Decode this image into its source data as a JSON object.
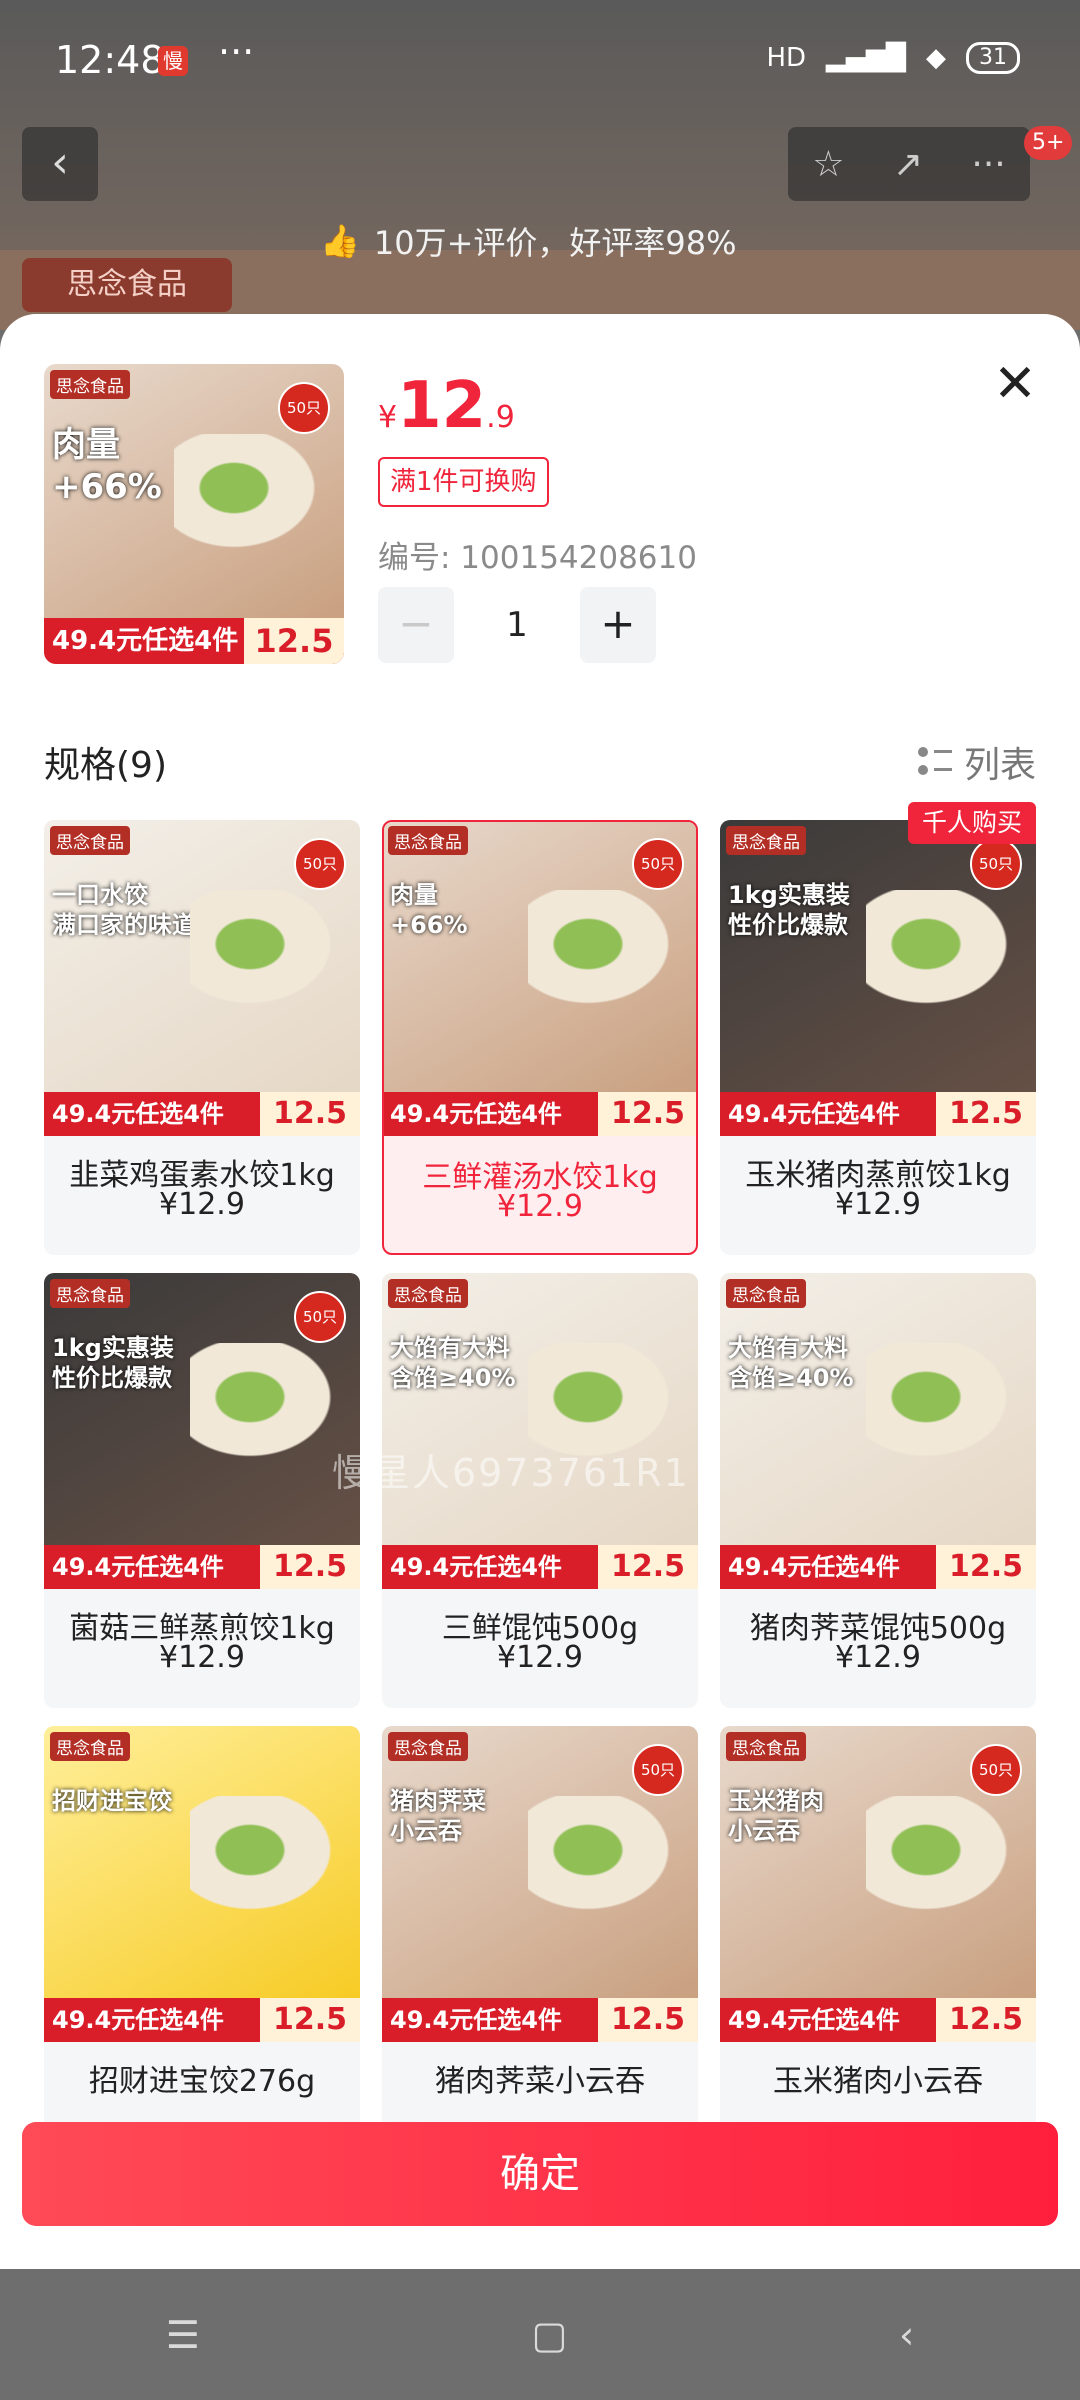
{
  "status_bar": {
    "time": "12:48",
    "app_badge": "慢",
    "more": "···",
    "network": "HD",
    "battery": "31"
  },
  "nav": {
    "back": "‹",
    "actions": [
      "☆",
      "↗",
      "···"
    ],
    "badge": "5+"
  },
  "review_banner": {
    "icon": "thumbs-up-icon",
    "text": "10万+评价，好评率98%"
  },
  "bg_logo": "思念食品",
  "product": {
    "currency": "¥",
    "price_int": "12",
    "price_dec": ".9",
    "exchange_tag": "满1件可换购",
    "sku_code": "编号: 100154208610",
    "qty": {
      "minus": "−",
      "value": "1",
      "plus": "+"
    },
    "thumb": {
      "logo": "思念食品",
      "headline": "肉量\n+66%",
      "weight": "50只",
      "promo": "49.4元任选4件",
      "promo_price": "12.5"
    }
  },
  "close": "✕",
  "specs": {
    "title": "规格(9)",
    "view_toggle": "列表"
  },
  "cards": [
    {
      "name": "韭菜鸡蛋素水饺1kg",
      "price": "¥12.9",
      "selected": false,
      "style": "light",
      "headline": "一口水饺\n满口家的味道",
      "weight": "50只",
      "promo": "49.4元任选4件",
      "promo_price": "12.5"
    },
    {
      "name": "三鲜灌汤水饺1kg",
      "price": "¥12.9",
      "selected": true,
      "style": "normal",
      "headline": "肉量\n+66%",
      "weight": "50只",
      "promo": "49.4元任选4件",
      "promo_price": "12.5"
    },
    {
      "name": "玉米猪肉蒸煎饺1kg",
      "price": "¥12.9",
      "selected": false,
      "style": "dark",
      "headline": "1kg实惠装\n性价比爆款",
      "weight": "50只",
      "promo": "49.4元任选4件",
      "promo_price": "12.5",
      "hot_tag": "千人购买"
    },
    {
      "name": "菌菇三鲜蒸煎饺1kg",
      "price": "¥12.9",
      "selected": false,
      "style": "dark",
      "headline": "1kg实惠装\n性价比爆款",
      "weight": "50只",
      "promo": "49.4元任选4件",
      "promo_price": "12.5"
    },
    {
      "name": "三鲜馄饨500g",
      "price": "¥12.9",
      "selected": false,
      "style": "light",
      "headline": "大馅有大料\n含馅≥40%",
      "weight": "",
      "promo": "49.4元任选4件",
      "promo_price": "12.5"
    },
    {
      "name": "猪肉荠菜馄饨500g",
      "price": "¥12.9",
      "selected": false,
      "style": "light",
      "headline": "大馅有大料\n含馅≥40%",
      "weight": "",
      "promo": "49.4元任选4件",
      "promo_price": "12.5"
    },
    {
      "name": "招财进宝饺276g",
      "price": "",
      "selected": false,
      "style": "yellow",
      "headline": "招财进宝饺",
      "weight": "",
      "promo": "49.4元任选4件",
      "promo_price": "12.5"
    },
    {
      "name": "猪肉荠菜小云吞",
      "price": "",
      "selected": false,
      "style": "normal",
      "headline": "猪肉荠菜\n小云吞",
      "weight": "50只",
      "promo": "49.4元任选4件",
      "promo_price": "12.5"
    },
    {
      "name": "玉米猪肉小云吞",
      "price": "",
      "selected": false,
      "style": "normal",
      "headline": "玉米猪肉\n小云吞",
      "weight": "50只",
      "promo": "49.4元任选4件",
      "promo_price": "12.5"
    }
  ],
  "watermark": "慢星人6973761R1",
  "confirm_button": "确定",
  "system_nav": {
    "menu": "☰",
    "home": "▢",
    "back": "‹"
  },
  "colors": {
    "accent": "#f0243b",
    "promo_red": "#d91e2a"
  }
}
